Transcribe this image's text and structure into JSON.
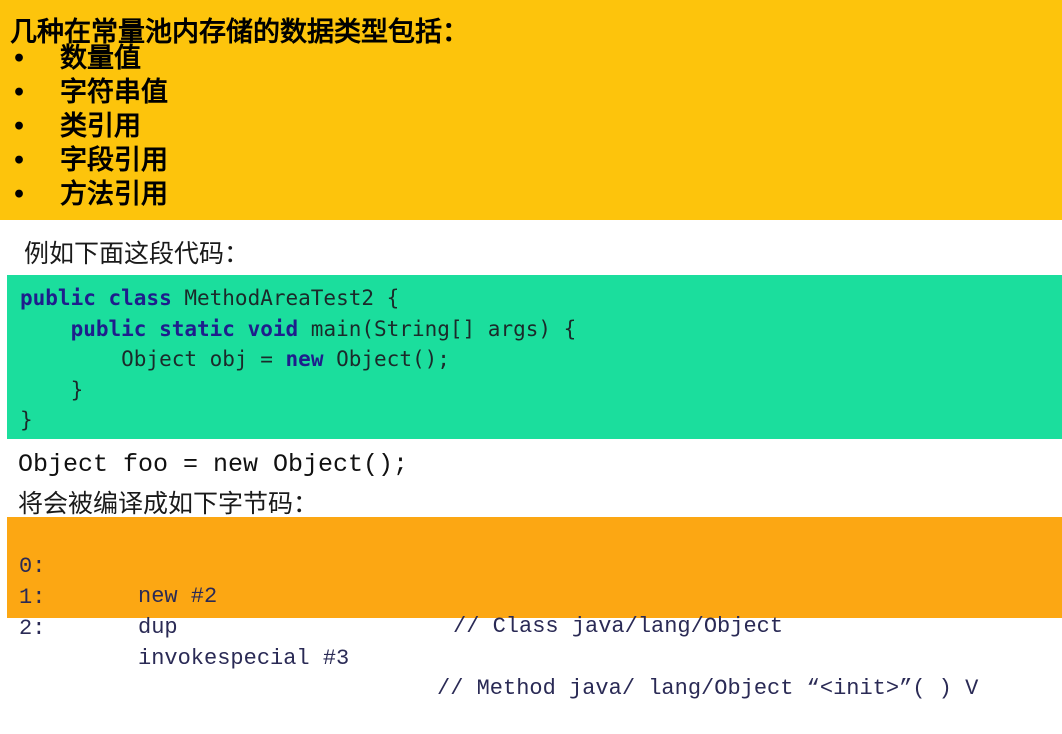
{
  "heading": {
    "lead": "几种在常量池内存储的数据类型包括：",
    "items": [
      "数量值",
      "字符串值",
      "类引用",
      "字段引用",
      "方法引用"
    ]
  },
  "example_caption": "例如下面这段代码：",
  "code": {
    "lines": [
      [
        "public class",
        " MethodAreaTest2 {"
      ],
      [
        "public static void",
        " main(String[] args) {"
      ],
      [
        "Object obj = ",
        "new",
        " Object();"
      ],
      [
        "}"
      ],
      [
        "}"
      ]
    ]
  },
  "object_line": "Object foo = new Object();",
  "bytecode_caption": "将会被编译成如下字节码：",
  "bytecode": [
    {
      "idx": "0:",
      "op": "new #2",
      "comment": "// Class java/lang/Object"
    },
    {
      "idx": "1:",
      "op": "dup",
      "comment": ""
    },
    {
      "idx": "2:",
      "op": "invokespecial #3",
      "comment": "// Method java/ lang/Object “<init>”( ) V"
    }
  ],
  "colors": {
    "yellow": "#fdc40c",
    "green": "#1bde9d",
    "orange": "#fca713",
    "keyword": "#1e1e8c"
  }
}
